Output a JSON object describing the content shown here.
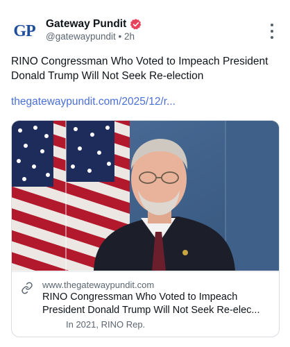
{
  "author": {
    "avatar_text": "GP",
    "name": "Gateway Pundit",
    "handle": "@gatewaypundit",
    "separator": "•",
    "time": "2h",
    "verified_icon": "verified-badge-icon"
  },
  "post": {
    "text": "RINO Congressman Who Voted to Impeach President Donald Trump Will Not Seek Re-election",
    "link_text": "thegatewaypundit.com/2025/12/r..."
  },
  "card": {
    "image_desc": "portrait-photo",
    "domain": "www.thegatewaypundit.com",
    "title": "RINO Congressman Who Voted to Impeach President Donald Trump Will Not Seek Re-elec...",
    "description": "In 2021, RINO Rep."
  },
  "colors": {
    "link": "#4a6fd6",
    "verified": "#e8435c",
    "avatar_text": "#1f4e9c",
    "secondary_text": "#5b6670"
  }
}
